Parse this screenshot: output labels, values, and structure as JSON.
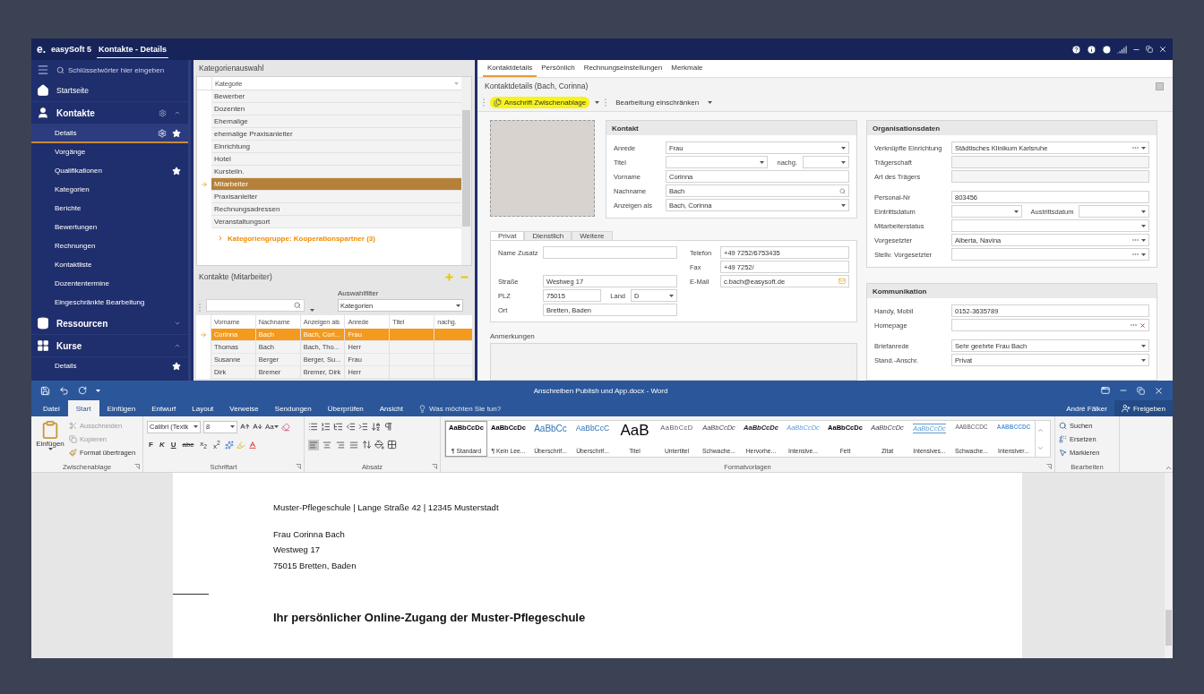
{
  "app": {
    "logo": "e.",
    "name": "easySoft 5",
    "tabs": [
      {
        "label": "Kontakte - Details",
        "selected": true
      }
    ]
  },
  "sidebar": {
    "search_placeholder": "Schlüsselwörter hier eingeben",
    "sections": [
      {
        "label": "Startseite",
        "kind": "link"
      },
      {
        "label": "Kontakte",
        "kind": "group",
        "expanded": true,
        "settings": true,
        "children": [
          {
            "label": "Details",
            "selected": true,
            "favorite": true,
            "settings": true
          },
          {
            "label": "Vorgänge",
            "selected": false,
            "favorite": false,
            "settings": false
          },
          {
            "label": "Qualifikationen",
            "selected": false,
            "favorite": true,
            "settings": false
          },
          {
            "label": "Kategorien",
            "selected": false,
            "favorite": false,
            "settings": false
          },
          {
            "label": "Berichte",
            "selected": false,
            "favorite": false,
            "settings": false
          },
          {
            "label": "Bewertungen",
            "selected": false,
            "favorite": false,
            "settings": false
          },
          {
            "label": "Rechnungen",
            "selected": false,
            "favorite": false,
            "settings": false
          },
          {
            "label": "Kontaktliste",
            "selected": false,
            "favorite": false,
            "settings": false
          },
          {
            "label": "Dozententermine",
            "selected": false,
            "favorite": false,
            "settings": false
          },
          {
            "label": "Eingeschränkte Bearbeitung",
            "selected": false,
            "favorite": false,
            "settings": false
          }
        ]
      },
      {
        "label": "Ressourcen",
        "kind": "group",
        "expanded": false,
        "settings": false
      },
      {
        "label": "Kurse",
        "kind": "group",
        "expanded": true,
        "settings": false,
        "children": [
          {
            "label": "Details",
            "selected": false,
            "favorite": true,
            "settings": false
          }
        ]
      }
    ]
  },
  "categories": {
    "title": "Kategorienauswahl",
    "column": "Kategorie",
    "items": [
      {
        "label": "Bewerber",
        "selected": false
      },
      {
        "label": "Dozenten",
        "selected": false
      },
      {
        "label": "Ehemalige",
        "selected": false
      },
      {
        "label": "ehemalige Praxisanleiter",
        "selected": false
      },
      {
        "label": "Einrichtung",
        "selected": false
      },
      {
        "label": "Hotel",
        "selected": false
      },
      {
        "label": "Kursteiln.",
        "selected": false
      },
      {
        "label": "Mitarbeiter",
        "selected": true
      },
      {
        "label": "Praxisanleiter",
        "selected": false
      },
      {
        "label": "Rechnungsadressen",
        "selected": false
      },
      {
        "label": "Veranstaltungsort",
        "selected": false
      }
    ],
    "group": {
      "label": "Kategoriengruppe: Kooperationspartner (3)",
      "expanded": false
    }
  },
  "contacts": {
    "title": "Kontakte (Mitarbeiter)",
    "filter_label": "Auswahlfilter",
    "filter_value": "Kategorien",
    "columns": [
      "Vorname",
      "Nachname",
      "Anzeigen als",
      "Anrede",
      "Titel",
      "nachg."
    ],
    "rows": [
      {
        "cells": [
          "Corinna",
          "Bach",
          "Bach, Cori...",
          "Frau"
        ],
        "selected": true
      },
      {
        "cells": [
          "Thomas",
          "Bach",
          "Bach, Tho...",
          "Herr"
        ],
        "selected": false
      },
      {
        "cells": [
          "Susanne",
          "Berger",
          "Berger, Su...",
          "Frau"
        ],
        "selected": false
      },
      {
        "cells": [
          "Dirk",
          "Bremer",
          "Bremer, Dirk",
          "Herr"
        ],
        "selected": false
      }
    ]
  },
  "details": {
    "tabs": [
      {
        "label": "Kontaktdetails",
        "selected": true
      },
      {
        "label": "Persönlich",
        "selected": false
      },
      {
        "label": "Rechnungseinstellungen",
        "selected": false
      },
      {
        "label": "Merkmale",
        "selected": false
      }
    ],
    "title": "Kontaktdetails (Bach, Corinna)",
    "toolbar": [
      {
        "label": "Anschrift Zwischenablage",
        "kind": "copy",
        "highlighted": true
      },
      {
        "label": "Bearbeitung einschränken",
        "kind": "plain",
        "highlighted": false
      }
    ],
    "kontakt": {
      "title": "Kontakt",
      "fields": [
        {
          "label": "Anrede",
          "kind": "combo",
          "value": "Frau"
        },
        {
          "label": "Titel",
          "kind": "combo",
          "suffix": {
            "label": "nachg.",
            "kind": "combo"
          }
        },
        {
          "label": "Vorname",
          "kind": "text",
          "value": "Corinna"
        },
        {
          "label": "Nachname",
          "kind": "search",
          "value": "Bach"
        },
        {
          "label": "Anzeigen als",
          "kind": "combo",
          "value": "Bach, Corinna"
        }
      ]
    },
    "address_tabs": [
      {
        "label": "Privat",
        "selected": true
      },
      {
        "label": "Dienstlich",
        "selected": false
      },
      {
        "label": "Weitere",
        "selected": false
      }
    ],
    "address": {
      "left_sets": [
        [
          {
            "label": "Name Zusatz",
            "kind": "text"
          }
        ],
        [
          {
            "label": "Straße",
            "kind": "text",
            "value": "Westweg 17"
          },
          {
            "label": "PLZ",
            "kind": "text",
            "value": "75015",
            "suffix": {
              "label": "Land",
              "kind": "combo",
              "value": "D"
            }
          },
          {
            "label": "Ort",
            "kind": "text",
            "value": "Bretten, Baden"
          }
        ]
      ],
      "right": [
        {
          "label": "Telefon",
          "kind": "text",
          "value": "+49 7252/6753435"
        },
        {
          "label": "Fax",
          "kind": "text",
          "value": "+49 7252/"
        },
        {
          "label": "E-Mail",
          "kind": "email",
          "value": "c.bach@easysoft.de"
        }
      ]
    },
    "notes_label": "Anmerkungen",
    "organisation": {
      "title": "Organisationsdaten",
      "field_sets": [
        [
          {
            "label": "Verknüpfte Einrichtung",
            "kind": "lookup",
            "value": "Städtisches Klinikum Karlsruhe"
          },
          {
            "label": "Trägerschaft",
            "kind": "readonly"
          },
          {
            "label": "Art des Trägers",
            "kind": "readonly"
          }
        ],
        [
          {
            "label": "Personal-Nr",
            "kind": "text",
            "value": "803456"
          },
          {
            "label": "Eintrittsdatum",
            "kind": "combo",
            "suffix": {
              "label": "Austrittsdatum",
              "kind": "combo"
            }
          },
          {
            "label": "Mitarbeiterstatus",
            "kind": "combo"
          },
          {
            "label": "Vorgesetzter",
            "kind": "lookup",
            "value": "Alberta, Navina"
          },
          {
            "label": "Stellv. Vorgesetzter",
            "kind": "lookup"
          }
        ]
      ]
    },
    "communication": {
      "title": "Kommunikation",
      "field_sets": [
        [
          {
            "label": "Handy, Mobil",
            "kind": "text",
            "value": "0152-3635789"
          },
          {
            "label": "Homepage",
            "kind": "link"
          }
        ],
        [
          {
            "label": "Briefanrede",
            "kind": "combo",
            "value": "Sehr geehrte Frau Bach"
          },
          {
            "label": "Stand.-Anschr.",
            "kind": "combo",
            "value": "Privat"
          }
        ]
      ]
    }
  },
  "word": {
    "title": "Anschreiben Publish und App.docx - Word",
    "tabs": [
      {
        "label": "Datei",
        "selected": false
      },
      {
        "label": "Start",
        "selected": true
      },
      {
        "label": "Einfügen",
        "selected": false
      },
      {
        "label": "Entwurf",
        "selected": false
      },
      {
        "label": "Layout",
        "selected": false
      },
      {
        "label": "Verweise",
        "selected": false
      },
      {
        "label": "Sendungen",
        "selected": false
      },
      {
        "label": "Überprüfen",
        "selected": false
      },
      {
        "label": "Ansicht",
        "selected": false
      }
    ],
    "tell_me": "Was möchten Sie tun?",
    "user": "André Fälker",
    "share": "Freigeben",
    "clipboard": {
      "label": "Zwischenablage",
      "paste": "Einfügen",
      "actions": [
        {
          "label": "Ausschneiden",
          "disabled": true
        },
        {
          "label": "Kopieren",
          "disabled": true
        },
        {
          "label": "Format übertragen",
          "disabled": false
        }
      ]
    },
    "font": {
      "label": "Schriftart",
      "name": "Calibri (Textk",
      "size": "8",
      "case": "Aa",
      "formats": [
        {
          "label": "F",
          "kind": "bold"
        },
        {
          "label": "K",
          "kind": "italic"
        },
        {
          "label": "U",
          "kind": "underline"
        },
        {
          "label": "abc",
          "kind": "strike"
        },
        {
          "label": "x$_{2}$",
          "kind": "sub"
        },
        {
          "label": "x$^{2}$",
          "kind": "sup"
        }
      ]
    },
    "paragraph": {
      "label": "Absatz",
      "align": [
        {
          "kind": "left",
          "selected": true
        },
        {
          "kind": "center",
          "selected": false
        },
        {
          "kind": "right",
          "selected": false
        },
        {
          "kind": "justify",
          "selected": false
        }
      ]
    },
    "styles": {
      "label": "Formatvorlagen",
      "items": [
        {
          "preview": "AaBbCcDc",
          "name": "¶ Standard",
          "kind": "standard",
          "selected": true
        },
        {
          "preview": "AaBbCcDc",
          "name": "¶ Kein Lee...",
          "kind": "standard",
          "selected": false
        },
        {
          "preview": "AaBbCc",
          "name": "Überschrif...",
          "kind": "heading1",
          "selected": false
        },
        {
          "preview": "AaBbCcC",
          "name": "Überschrif...",
          "kind": "heading2",
          "selected": false
        },
        {
          "preview": "AaB",
          "name": "Titel",
          "kind": "title",
          "selected": false
        },
        {
          "preview": "AaBbCcD",
          "name": "Untertitel",
          "kind": "subtitle",
          "selected": false
        },
        {
          "preview": "AaBbCcDc",
          "name": "Schwache...",
          "kind": "subtle",
          "selected": false
        },
        {
          "preview": "AaBbCcDc",
          "name": "Hervorhe...",
          "kind": "emphasis",
          "selected": false
        },
        {
          "preview": "AaBbCcDc",
          "name": "Intensive...",
          "kind": "intense",
          "selected": false
        },
        {
          "preview": "AaBbCcDc",
          "name": "Fett",
          "kind": "strong",
          "selected": false
        },
        {
          "preview": "AaBbCcDc",
          "name": "Zitat",
          "kind": "subtle",
          "selected": false
        },
        {
          "preview": "AaBbCcDc",
          "name": "Intensives...",
          "kind": "intensequote",
          "selected": false
        },
        {
          "preview": "AABBCCDC",
          "name": "Schwache...",
          "kind": "subtleref",
          "selected": false
        },
        {
          "preview": "AABBCCDC",
          "name": "Intensiver...",
          "kind": "intenseref",
          "selected": false
        }
      ]
    },
    "editing": {
      "label": "Bearbeiten",
      "items": [
        {
          "label": "Suchen",
          "kind": "find"
        },
        {
          "label": "Ersetzen",
          "kind": "replace"
        },
        {
          "label": "Markieren",
          "kind": "select"
        }
      ]
    }
  },
  "document": {
    "sender": "Muster-Pflegeschule | Lange Straße 42 | 12345 Musterstadt",
    "address": [
      "Frau Corinna Bach",
      "Westweg 17",
      "75015 Bretten, Baden"
    ],
    "subject": "Ihr persönlicher Online-Zugang der Muster-Pflegeschule"
  }
}
